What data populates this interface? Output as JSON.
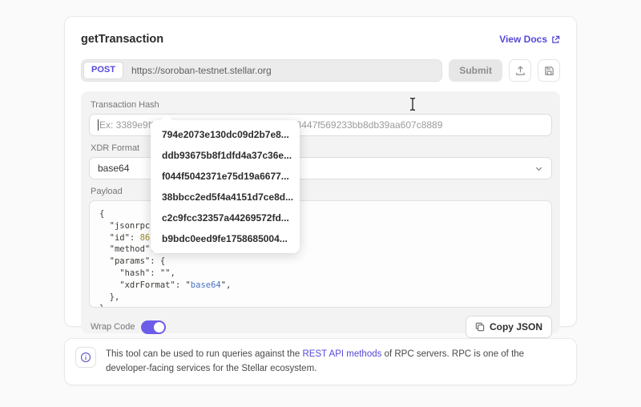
{
  "colors": {
    "accent": "#5648D8",
    "toggle": "#6C5CE8"
  },
  "header": {
    "title": "getTransaction",
    "view_docs": "View Docs"
  },
  "request": {
    "method": "POST",
    "url": "https://soroban-testnet.stellar.org",
    "submit_label": "Submit"
  },
  "form": {
    "hash_label": "Transaction Hash",
    "hash_placeholder": "Ex: 3389e9f0f1a65f19736cacf544c2e825313e8447f569233bb8db39aa607c8889",
    "xdr_label": "XDR Format",
    "xdr_value": "base64",
    "payload_label": "Payload"
  },
  "dropdown": {
    "items": [
      "794e2073e130dc09d2b7e8...",
      "ddb93675b8f1dfd4a37c36e...",
      "f044f5042371e75d19a6677...",
      "38bbcc2ed5f4a4151d7ce8d...",
      "c2c9fcc32357a44269572fd...",
      "b9bdc0eed9fe1758685004..."
    ]
  },
  "payload_code": {
    "colors": {
      "plain": "#3a3a35",
      "num": "#95892E",
      "str": "#4A70C4"
    },
    "lines": [
      {
        "tokens": [
          {
            "t": "{",
            "c": "plain"
          }
        ]
      },
      {
        "tokens": [
          {
            "t": "  \"jsonrpc\": ",
            "c": "plain"
          }
        ]
      },
      {
        "tokens": [
          {
            "t": "  \"id\": ",
            "c": "plain"
          },
          {
            "t": "86753",
            "c": "num"
          }
        ]
      },
      {
        "tokens": [
          {
            "t": "  \"method\": \"",
            "c": "plain"
          }
        ]
      },
      {
        "tokens": [
          {
            "t": "  \"params\": {",
            "c": "plain"
          }
        ]
      },
      {
        "tokens": [
          {
            "t": "    \"hash\": \"\",",
            "c": "plain"
          }
        ]
      },
      {
        "tokens": [
          {
            "t": "    \"xdrFormat\": \"",
            "c": "plain"
          },
          {
            "t": "base64",
            "c": "str"
          },
          {
            "t": "\",",
            "c": "plain"
          }
        ]
      },
      {
        "tokens": [
          {
            "t": "  },",
            "c": "plain"
          }
        ]
      },
      {
        "tokens": [
          {
            "t": "}",
            "c": "plain"
          }
        ]
      }
    ]
  },
  "footer_controls": {
    "wrap_label": "Wrap Code",
    "wrap_on": true,
    "copy_label": "Copy JSON"
  },
  "info": {
    "text_before": "This tool can be used to run queries against the ",
    "link": "REST API methods",
    "text_after": " of RPC servers. RPC is one of the developer-facing services for the Stellar ecosystem."
  }
}
